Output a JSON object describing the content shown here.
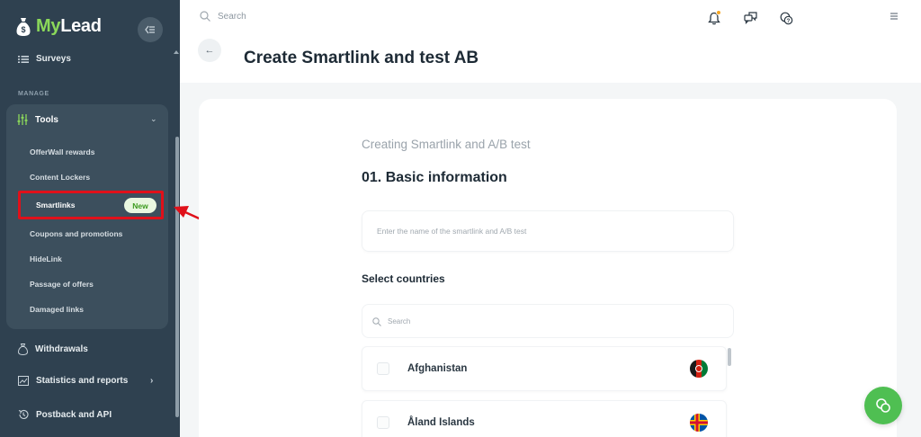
{
  "app": {
    "logo_my": "My",
    "logo_lead": "Lead"
  },
  "sidebar": {
    "surveys": "Surveys",
    "manage_label": "MANAGE",
    "tools": {
      "label": "Tools",
      "items": [
        {
          "label": "OfferWall rewards"
        },
        {
          "label": "Content Lockers"
        },
        {
          "label": "Smartlinks",
          "badge": "New",
          "active": true
        },
        {
          "label": "Coupons and promotions"
        },
        {
          "label": "HideLink"
        },
        {
          "label": "Passage of offers"
        },
        {
          "label": "Damaged links"
        }
      ]
    },
    "withdrawals": "Withdrawals",
    "statistics": "Statistics and reports",
    "postback": "Postback and API"
  },
  "topbar": {
    "search_placeholder": "Search"
  },
  "header": {
    "title": "Create Smartlink and test AB"
  },
  "form": {
    "subtitle": "Creating Smartlink and A/B test",
    "section_title": "01. Basic information",
    "name_placeholder": "Enter the name of the smartlink and A/B test",
    "countries_label": "Select countries",
    "country_search_placeholder": "Search",
    "countries": [
      {
        "name": "Afghanistan",
        "flag": "afghanistan-flag-icon"
      },
      {
        "name": "Åland Islands",
        "flag": "aland-islands-flag-icon"
      }
    ]
  },
  "colors": {
    "sidebar": "#2f4150",
    "accent_green": "#8bd95a",
    "highlight_red": "#e0101a",
    "fab_green": "#4fbf52"
  }
}
